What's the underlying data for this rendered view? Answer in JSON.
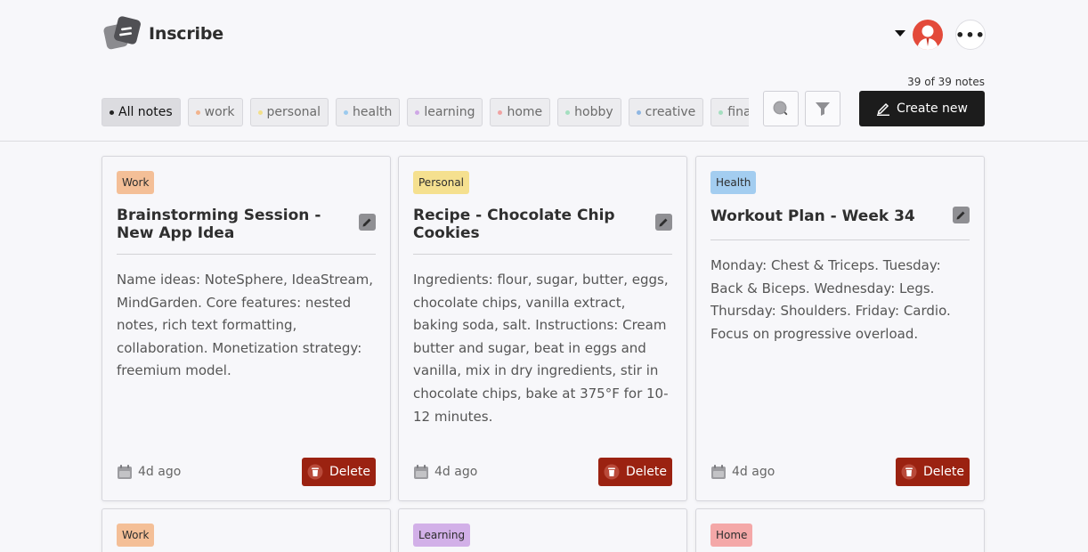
{
  "app": {
    "name": "Inscribe"
  },
  "header": {
    "notes_count": "39 of 39 notes",
    "create_label": "Create new"
  },
  "filters": [
    {
      "label": "All notes",
      "dot": "#222222",
      "active": true
    },
    {
      "label": "work",
      "dot": "#f2b48e"
    },
    {
      "label": "personal",
      "dot": "#f3e08a"
    },
    {
      "label": "health",
      "dot": "#9ccaee"
    },
    {
      "label": "learning",
      "dot": "#cfa8e6"
    },
    {
      "label": "home",
      "dot": "#f0a3a3"
    },
    {
      "label": "hobby",
      "dot": "#a5dfc0"
    },
    {
      "label": "creative",
      "dot": "#8fb7e3"
    },
    {
      "label": "finan",
      "dot": "#a5dfc0"
    }
  ],
  "notes": [
    {
      "tag": "Work",
      "tag_color": "#f4bf97",
      "title": "Brainstorming Session - New App Idea",
      "body": "Name ideas: NoteSphere, IdeaStream, MindGarden. Core features: nested notes, rich text formatting, collaboration. Monetization strategy: freemium model.",
      "date": "4d ago",
      "delete_label": "Delete"
    },
    {
      "tag": "Personal",
      "tag_color": "#f5e08f",
      "title": "Recipe - Chocolate Chip Cookies",
      "body": "Ingredients: flour, sugar, butter, eggs, chocolate chips, vanilla extract, baking soda, salt. Instructions: Cream butter and sugar, beat in eggs and vanilla, mix in dry ingredients, stir in chocolate chips, bake at 375°F for 10-12 minutes.",
      "date": "4d ago",
      "delete_label": "Delete"
    },
    {
      "tag": "Health",
      "tag_color": "#a3cdf0",
      "title": "Workout Plan - Week 34",
      "body": "Monday: Chest & Triceps. Tuesday: Back & Biceps. Wednesday: Legs. Thursday: Shoulders. Friday: Cardio. Focus on progressive overload.",
      "date": "4d ago",
      "delete_label": "Delete"
    },
    {
      "tag": "Work",
      "tag_color": "#f4bf97"
    },
    {
      "tag": "Learning",
      "tag_color": "#d2b0e8"
    },
    {
      "tag": "Home",
      "tag_color": "#f4a8a8"
    }
  ]
}
